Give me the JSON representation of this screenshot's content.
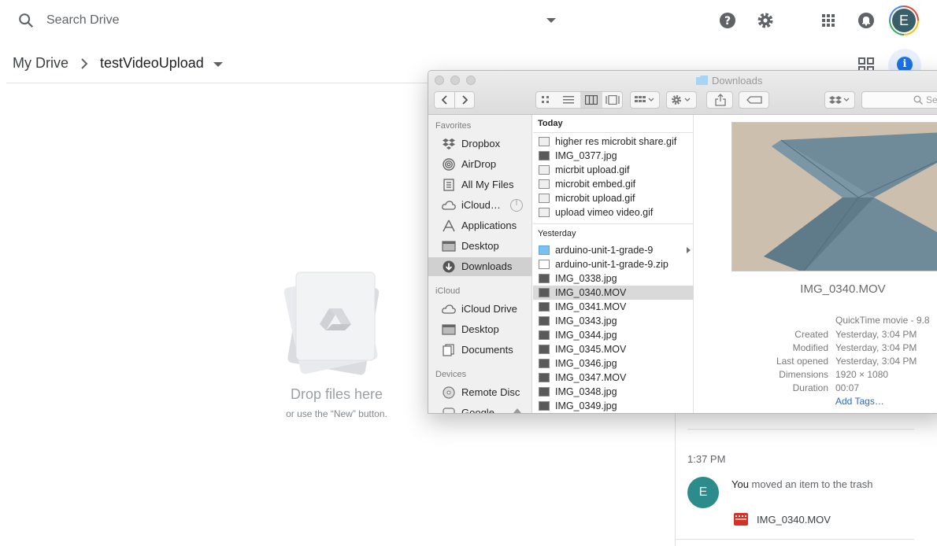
{
  "drive": {
    "search_placeholder": "Search Drive",
    "avatar_letter": "E",
    "breadcrumb": {
      "root": "My Drive",
      "current": "testVideoUpload"
    },
    "empty_state": {
      "title": "Drop files here",
      "subtitle": "or use the “New” button."
    },
    "info_glyph": "i"
  },
  "activity": {
    "time": "1:37 PM",
    "avatar_letter": "E",
    "actor": "You",
    "action": " moved an item to the trash",
    "file": "IMG_0340.MOV"
  },
  "finder": {
    "title": "Downloads",
    "search_placeholder": "Se",
    "sidebar": [
      {
        "heading": "Favorites",
        "items": [
          "Dropbox",
          "AirDrop",
          "All My Files",
          "iCloud…",
          "Applications",
          "Desktop",
          "Downloads"
        ]
      },
      {
        "heading": "iCloud",
        "items": [
          "iCloud Drive",
          "Desktop",
          "Documents"
        ]
      },
      {
        "heading": "Devices",
        "items": [
          "Remote Disc",
          "Google…"
        ]
      }
    ],
    "selected_sidebar": "Downloads",
    "groups": [
      {
        "heading": "Today",
        "files": [
          "higher res microbit share.gif",
          "IMG_0377.jpg",
          "micrbit upload.gif",
          "microbit embed.gif",
          "microbit upload.gif",
          "upload vimeo video.gif"
        ]
      },
      {
        "heading": "Yesterday",
        "files": [
          "arduino-unit-1-grade-9",
          "arduino-unit-1-grade-9.zip",
          "IMG_0338.jpg",
          "IMG_0340.MOV",
          "IMG_0341.MOV",
          "IMG_0343.jpg",
          "IMG_0344.jpg",
          "IMG_0345.MOV",
          "IMG_0346.jpg",
          "IMG_0347.MOV",
          "IMG_0348.jpg",
          "IMG_0349.jpg"
        ]
      }
    ],
    "selected_file": "IMG_0340.MOV",
    "preview": {
      "name": "IMG_0340.MOV",
      "kind": "QuickTime movie - 9.8",
      "meta": [
        {
          "key": "Created",
          "value": "Yesterday, 3:04 PM"
        },
        {
          "key": "Modified",
          "value": "Yesterday, 3:04 PM"
        },
        {
          "key": "Last opened",
          "value": "Yesterday, 3:04 PM"
        },
        {
          "key": "Dimensions",
          "value": "1920 × 1080"
        },
        {
          "key": "Duration",
          "value": "00:07"
        }
      ],
      "add_tags": "Add Tags…"
    }
  }
}
